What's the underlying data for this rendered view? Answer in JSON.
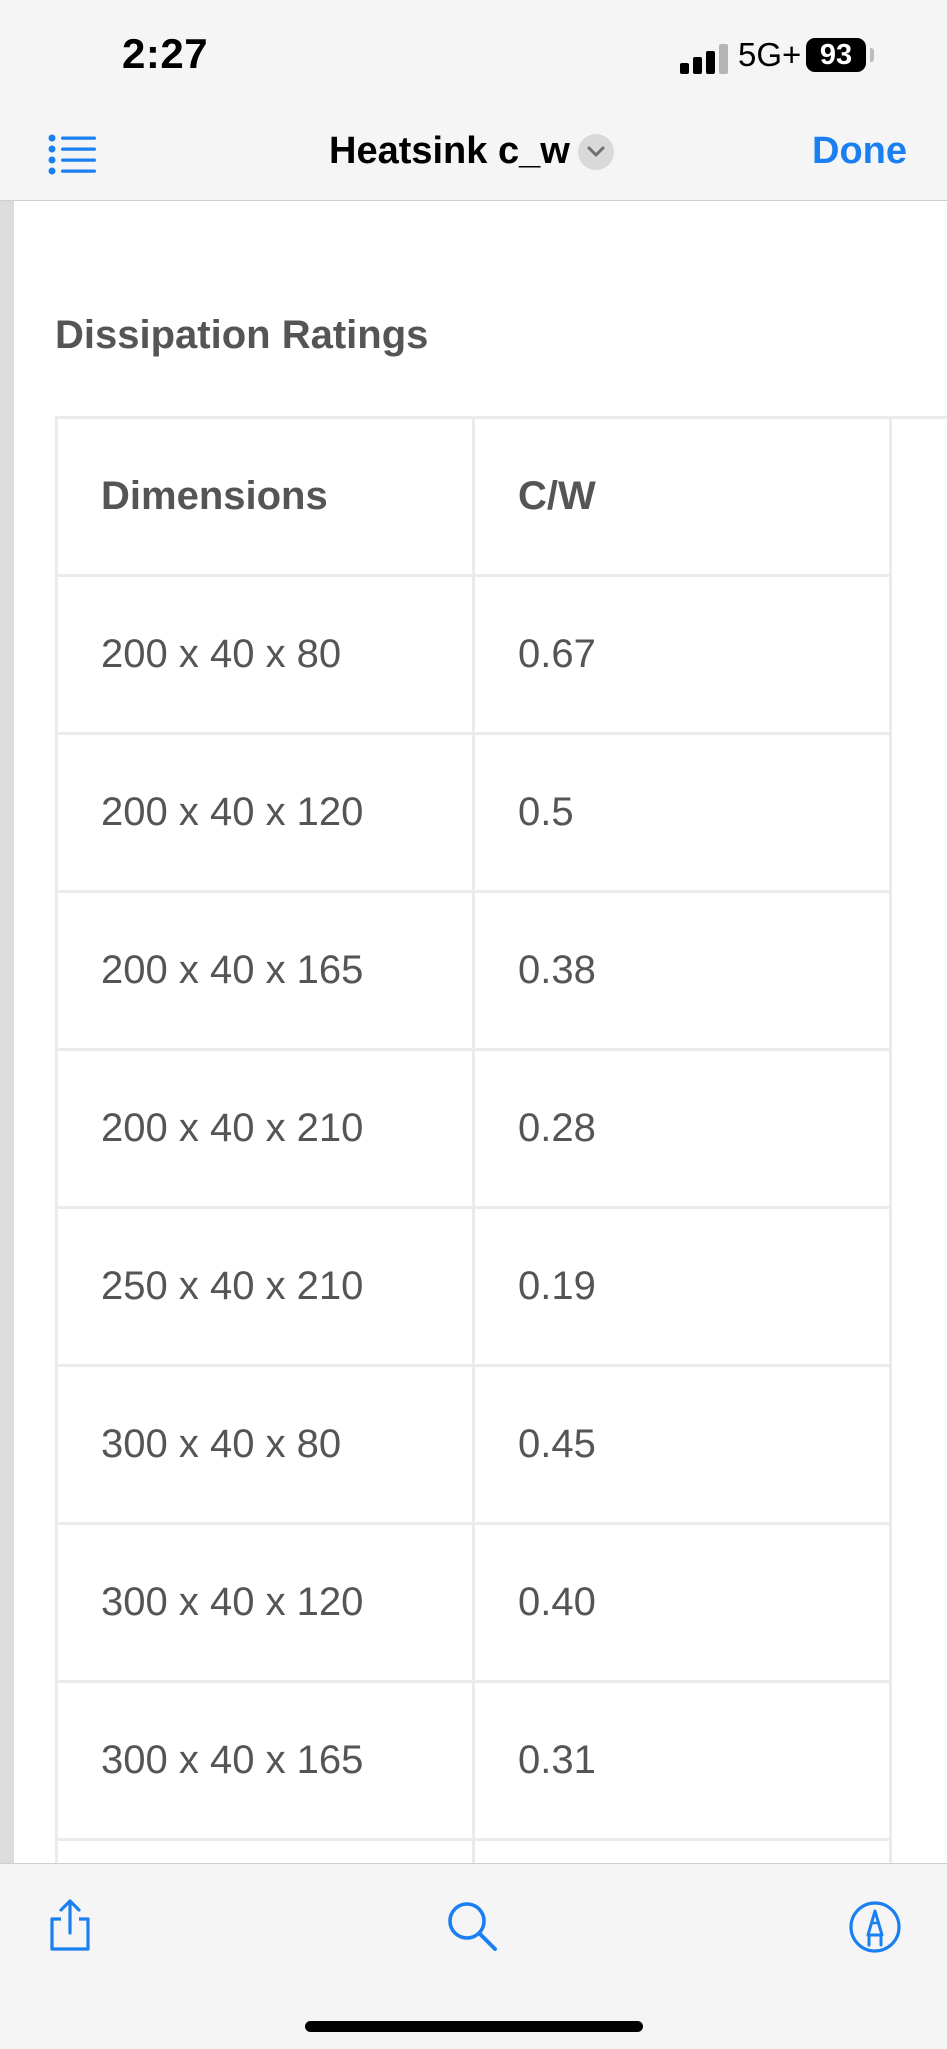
{
  "status_bar": {
    "time": "2:27",
    "network": "5G+",
    "battery": "93"
  },
  "nav": {
    "menu_icon": "list-icon",
    "title": "Heatsink c_w",
    "title_menu_icon": "chevron-down-icon",
    "done_label": "Done",
    "accent_color": "#1a7ff0"
  },
  "document": {
    "heading": "Dissipation Ratings",
    "table": {
      "headers": [
        "Dimensions",
        "C/W"
      ],
      "rows": [
        [
          "200 x 40 x 80",
          "0.67"
        ],
        [
          "200 x 40 x 120",
          "0.5"
        ],
        [
          "200 x 40 x 165",
          "0.38"
        ],
        [
          "200 x 40 x 210",
          "0.28"
        ],
        [
          "250 x 40 x 210",
          "0.19"
        ],
        [
          "300 x 40 x 80",
          "0.45"
        ],
        [
          "300 x 40 x 120",
          "0.40"
        ],
        [
          "300 x 40 x 165",
          "0.31"
        ],
        [
          "",
          ""
        ]
      ]
    }
  },
  "toolbar": {
    "share_icon": "share-icon",
    "search_icon": "search-icon",
    "markup_icon": "markup-pen-icon"
  }
}
